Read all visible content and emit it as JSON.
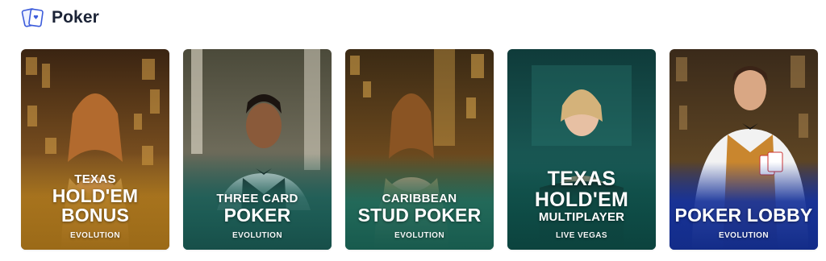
{
  "section": {
    "title": "Poker",
    "icon": "cards-icon"
  },
  "games": [
    {
      "lines": [
        "TEXAS",
        "HOLD'EM",
        "BONUS"
      ],
      "provider": "EVOLUTION",
      "accent": "#b07a1e"
    },
    {
      "lines": [
        "THREE CARD",
        "POKER"
      ],
      "provider": "EVOLUTION",
      "accent": "#1e5f58"
    },
    {
      "lines": [
        "CARIBBEAN",
        "STUD POKER"
      ],
      "provider": "EVOLUTION",
      "accent": "#1f6b5c"
    },
    {
      "lines": [
        "TEXAS",
        "HOLD'EM",
        "MULTIPLAYER"
      ],
      "provider": "LIVE VEGAS",
      "accent": "#0f4e48"
    },
    {
      "lines": [
        "POKER LOBBY"
      ],
      "provider": "EVOLUTION",
      "accent": "#16329a"
    }
  ]
}
